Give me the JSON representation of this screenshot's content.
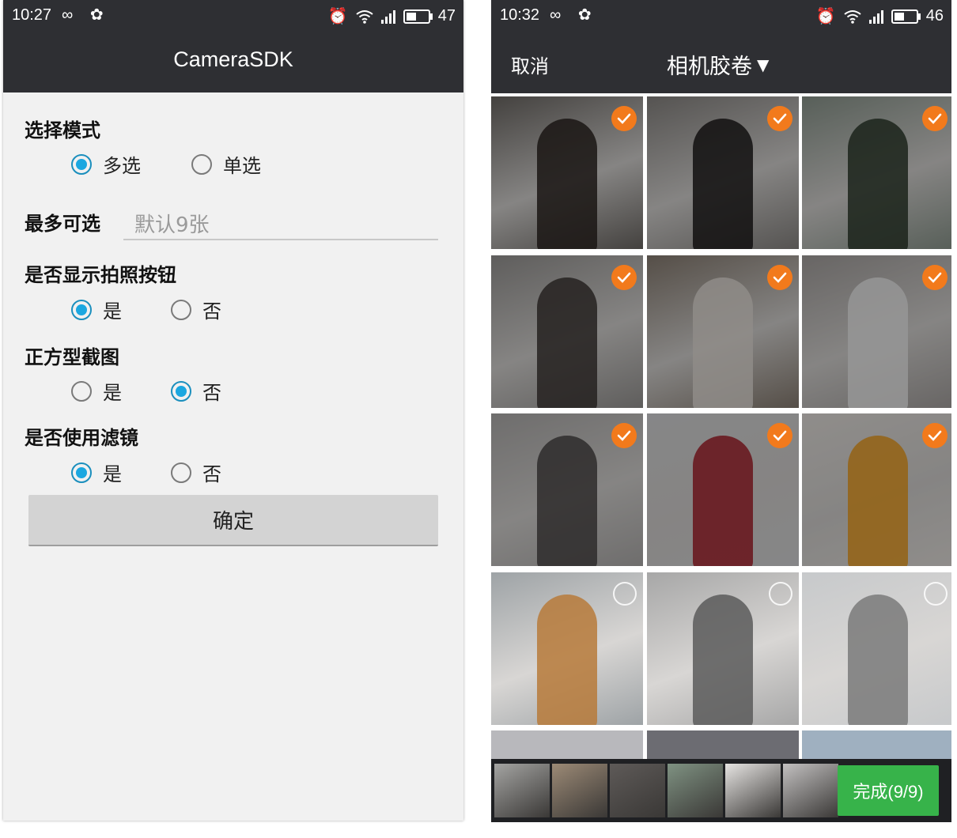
{
  "left": {
    "status": {
      "time": "10:27",
      "battery": "47",
      "battery_level": 0.47
    },
    "app_title": "CameraSDK",
    "select_mode": {
      "label": "选择模式",
      "options": [
        "多选",
        "单选"
      ],
      "selected": "多选"
    },
    "max_select": {
      "label": "最多可选",
      "placeholder": "默认9张"
    },
    "show_camera": {
      "label": "是否显示拍照按钮",
      "options": [
        "是",
        "否"
      ],
      "selected": "是"
    },
    "square_crop": {
      "label": "正方型截图",
      "options": [
        "是",
        "否"
      ],
      "selected": "否"
    },
    "use_filter": {
      "label": "是否使用滤镜",
      "options": [
        "是",
        "否"
      ],
      "selected": "是"
    },
    "confirm_label": "确定"
  },
  "right": {
    "status": {
      "time": "10:32",
      "battery": "46",
      "battery_level": 0.46
    },
    "cancel_label": "取消",
    "album_title": "相机胶卷",
    "done_label": "完成(9/9)",
    "photos": [
      {
        "selected": true,
        "bg": "#6e6a66",
        "fg": "#2a2320"
      },
      {
        "selected": true,
        "bg": "#8a8784",
        "fg": "#1c1a1a"
      },
      {
        "selected": true,
        "bg": "#8e9a90",
        "fg": "#2d3a2c"
      },
      {
        "selected": true,
        "bg": "#9a9896",
        "fg": "#3c3634"
      },
      {
        "selected": true,
        "bg": "#8a7f74",
        "fg": "#e8e2dc"
      },
      {
        "selected": true,
        "bg": "#a8a4a2",
        "fg": "#f2f2f2"
      },
      {
        "selected": true,
        "bg": "#b3b1b0",
        "fg": "#4a4646"
      },
      {
        "selected": true,
        "bg": "#d9d9db",
        "fg": "#a8202a"
      },
      {
        "selected": true,
        "bg": "#e8e4e0",
        "fg": "#f0a020"
      },
      {
        "selected": false,
        "bg": "#9ea3a6",
        "fg": "#b77a3a"
      },
      {
        "selected": false,
        "bg": "#a7a7a7",
        "fg": "#5a5a5a"
      },
      {
        "selected": false,
        "bg": "#c7c9cb",
        "fg": "#7a7a7a"
      }
    ],
    "tray": [
      {
        "bg": "#a4a4a2"
      },
      {
        "bg": "#9c8a76"
      },
      {
        "bg": "#5e5a58"
      },
      {
        "bg": "#7f9282"
      },
      {
        "bg": "#e6e4e2"
      },
      {
        "bg": "#c2c0c0"
      }
    ]
  }
}
